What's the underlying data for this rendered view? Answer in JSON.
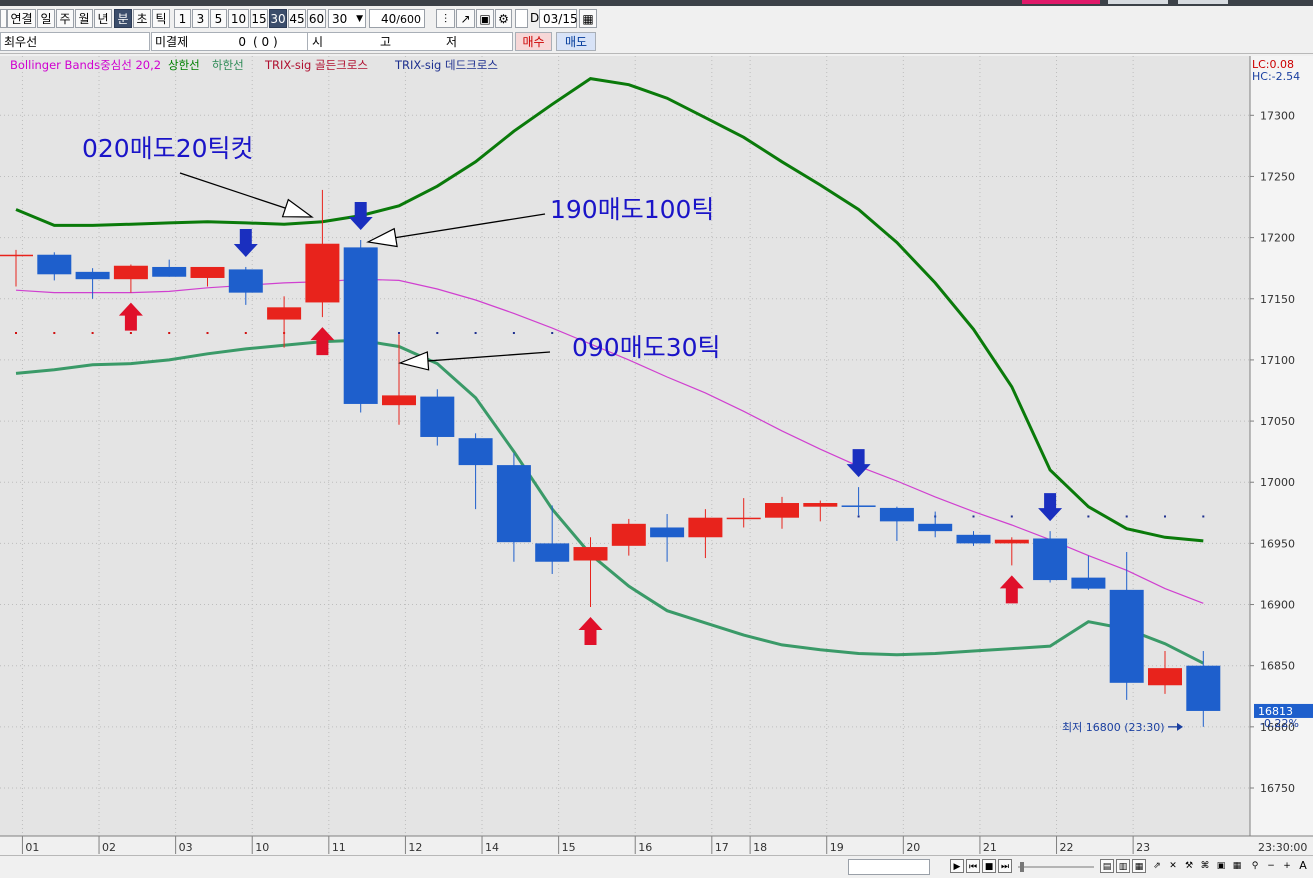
{
  "toolbar": {
    "period_buttons": [
      "연결",
      "일",
      "주",
      "월",
      "년",
      "분",
      "초",
      "틱"
    ],
    "selected_period": "분",
    "interval_buttons": [
      "1",
      "3",
      "5",
      "10",
      "15",
      "30",
      "45",
      "60"
    ],
    "selected_interval": "30",
    "interval_select": "30",
    "count_value": "40",
    "count_max": "/600",
    "date_value": "03/15"
  },
  "infobar": {
    "order_type": "최우선",
    "unfilled_label": "미결제",
    "unfilled_value": "0",
    "unfilled_paren": "(     0     )",
    "open_label": "시",
    "high_label": "고",
    "low_label": "저",
    "buy_button": "매수",
    "sell_button": "매도"
  },
  "legend": {
    "items": [
      {
        "text": "Bollinger Bands중심선 20,2",
        "color": "#d000d0"
      },
      {
        "text": "상한선",
        "color": "#008000"
      },
      {
        "text": "하한선",
        "color": "#2e8b57"
      },
      {
        "text": "TRIX-sig 골든크로스",
        "color": "#b01030"
      },
      {
        "text": "TRIX-sig 데드크로스",
        "color": "#1d2f8f"
      }
    ],
    "lc": "LC:0.08",
    "hc": "HC:-2.54"
  },
  "colors": {
    "up": "#e8231c",
    "down": "#1e5fcc",
    "upper_band": "#0a7a0a",
    "lower_band": "#3a9a68",
    "middle_band": "#d040d0",
    "annotation": "#1a14c8",
    "plot_bg": "#e4e4e4"
  },
  "chart_data": {
    "type": "candlestick",
    "x_tick_labels": [
      {
        "label": "01",
        "i": 0.25
      },
      {
        "label": "02",
        "i": 2.25
      },
      {
        "label": "03",
        "i": 4.25
      },
      {
        "label": "10",
        "i": 6.25
      },
      {
        "label": "11",
        "i": 8.25
      },
      {
        "label": "12",
        "i": 10.25
      },
      {
        "label": "14",
        "i": 12.25
      },
      {
        "label": "15",
        "i": 14.25
      },
      {
        "label": "16",
        "i": 16.25
      },
      {
        "label": "17",
        "i": 18.25
      },
      {
        "label": "18",
        "i": 19.25
      },
      {
        "label": "19",
        "i": 21.25
      },
      {
        "label": "20",
        "i": 23.25
      },
      {
        "label": "21",
        "i": 25.25
      },
      {
        "label": "22",
        "i": 27.25
      },
      {
        "label": "23",
        "i": 29.25
      }
    ],
    "time_label": "23:30:00",
    "y_ticks": [
      16750,
      16800,
      16850,
      16900,
      16950,
      17000,
      17050,
      17100,
      17150,
      17200,
      17250,
      17300
    ],
    "ylim": [
      16710,
      17340
    ],
    "candles": [
      {
        "o": 17186,
        "h": 17190,
        "l": 17160,
        "c": 17186
      },
      {
        "o": 17186,
        "h": 17188,
        "l": 17165,
        "c": 17170
      },
      {
        "o": 17172,
        "h": 17175,
        "l": 17150,
        "c": 17166
      },
      {
        "o": 17166,
        "h": 17178,
        "l": 17155,
        "c": 17177
      },
      {
        "o": 17176,
        "h": 17182,
        "l": 17168,
        "c": 17168
      },
      {
        "o": 17167,
        "h": 17173,
        "l": 17160,
        "c": 17176
      },
      {
        "o": 17174,
        "h": 17176,
        "l": 17145,
        "c": 17155
      },
      {
        "o": 17133,
        "h": 17152,
        "l": 17110,
        "c": 17143
      },
      {
        "o": 17147,
        "h": 17239,
        "l": 17135,
        "c": 17195
      },
      {
        "o": 17192,
        "h": 17198,
        "l": 17057,
        "c": 17064
      },
      {
        "o": 17063,
        "h": 17121,
        "l": 17047,
        "c": 17071
      },
      {
        "o": 17070,
        "h": 17076,
        "l": 17030,
        "c": 17037
      },
      {
        "o": 17036,
        "h": 17040,
        "l": 16978,
        "c": 17014
      },
      {
        "o": 17014,
        "h": 17024,
        "l": 16935,
        "c": 16951
      },
      {
        "o": 16950,
        "h": 16981,
        "l": 16925,
        "c": 16935
      },
      {
        "o": 16936,
        "h": 16955,
        "l": 16898,
        "c": 16947
      },
      {
        "o": 16948,
        "h": 16970,
        "l": 16940,
        "c": 16966
      },
      {
        "o": 16963,
        "h": 16974,
        "l": 16935,
        "c": 16955
      },
      {
        "o": 16955,
        "h": 16978,
        "l": 16938,
        "c": 16971
      },
      {
        "o": 16970,
        "h": 16987,
        "l": 16963,
        "c": 16971
      },
      {
        "o": 16971,
        "h": 16988,
        "l": 16962,
        "c": 16983
      },
      {
        "o": 16980,
        "h": 16985,
        "l": 16968,
        "c": 16983
      },
      {
        "o": 16981,
        "h": 16996,
        "l": 16973,
        "c": 16980
      },
      {
        "o": 16979,
        "h": 16980,
        "l": 16952,
        "c": 16968
      },
      {
        "o": 16966,
        "h": 16976,
        "l": 16955,
        "c": 16960
      },
      {
        "o": 16957,
        "h": 16960,
        "l": 16948,
        "c": 16950
      },
      {
        "o": 16950,
        "h": 16955,
        "l": 16932,
        "c": 16953
      },
      {
        "o": 16954,
        "h": 16960,
        "l": 16918,
        "c": 16920
      },
      {
        "o": 16922,
        "h": 16940,
        "l": 16912,
        "c": 16913
      },
      {
        "o": 16912,
        "h": 16943,
        "l": 16822,
        "c": 16836
      },
      {
        "o": 16834,
        "h": 16862,
        "l": 16827,
        "c": 16848
      },
      {
        "o": 16850,
        "h": 16862,
        "l": 16800,
        "c": 16813
      }
    ],
    "upper_band": [
      17223,
      17210,
      17210,
      17211,
      17212,
      17213,
      17212,
      17211,
      17213,
      17218,
      17226,
      17242,
      17262,
      17287,
      17309,
      17330,
      17325,
      17314,
      17298,
      17282,
      17262,
      17243,
      17223,
      17196,
      17163,
      17125,
      17078,
      17010,
      16980,
      16962,
      16955,
      16952
    ],
    "lower_band": [
      17089,
      17092,
      17096,
      17097,
      17100,
      17105,
      17109,
      17112,
      17115,
      17116,
      17111,
      17097,
      17069,
      17025,
      16978,
      16941,
      16915,
      16895,
      16885,
      16875,
      16867,
      16863,
      16860,
      16859,
      16860,
      16862,
      16864,
      16866,
      16886,
      16880,
      16868,
      16852
    ],
    "middle_band": [
      17157,
      17155,
      17155,
      17155,
      17156,
      17159,
      17161,
      17163,
      17164,
      17166,
      17165,
      17158,
      17149,
      17138,
      17126,
      17113,
      17100,
      17086,
      17073,
      17058,
      17042,
      17027,
      17013,
      17001,
      16988,
      16976,
      16965,
      16953,
      16940,
      16928,
      16913,
      16901
    ],
    "red_dot_level": 17122,
    "blue_dot_level": 16972,
    "buy_arrows": [
      3,
      8,
      15,
      26
    ],
    "sell_arrows": [
      6,
      9,
      22,
      27
    ],
    "price_badge": "16813",
    "change_pct": "-0.22%",
    "low_label": "최저 16800 (23:30)",
    "annotations": [
      "020매도20틱컷",
      "190매도100틱",
      "090매도30틱"
    ]
  }
}
